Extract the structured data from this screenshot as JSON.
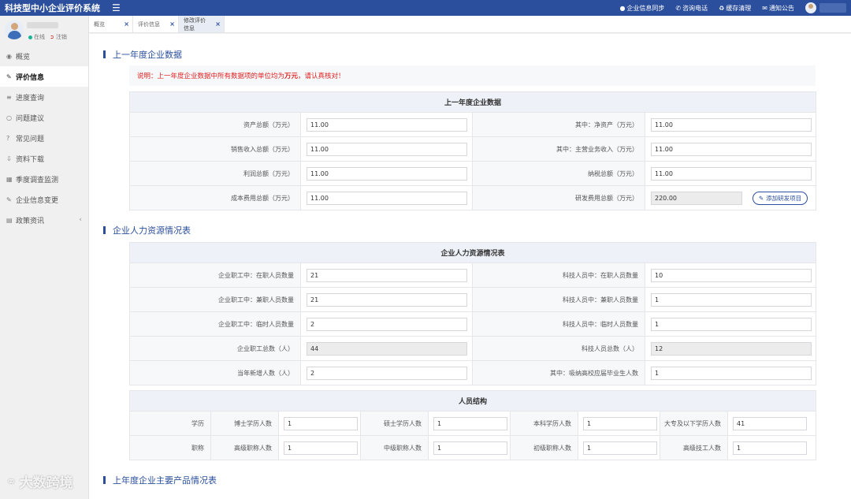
{
  "app": {
    "title": "科技型中小企业评价系统"
  },
  "topbar": {
    "actions": [
      {
        "icon": "user-icon",
        "label": "企业信息同步"
      },
      {
        "icon": "phone-icon",
        "label": "咨询电话"
      },
      {
        "icon": "recycle-icon",
        "label": "缓存清理"
      },
      {
        "icon": "mail-icon",
        "label": "通知公告"
      }
    ]
  },
  "sidebar": {
    "status_online": "在线",
    "status_logout": "注销",
    "items": [
      {
        "label": "概览",
        "icon": "dashboard-icon"
      },
      {
        "label": "评价信息",
        "icon": "edit-icon",
        "active": true
      },
      {
        "label": "进度查询",
        "icon": "progress-icon"
      },
      {
        "label": "问题建议",
        "icon": "chat-icon"
      },
      {
        "label": "常见问题",
        "icon": "question-icon"
      },
      {
        "label": "资料下载",
        "icon": "download-icon"
      },
      {
        "label": "季度调查监测",
        "icon": "grid-icon"
      },
      {
        "label": "企业信息变更",
        "icon": "edit-icon"
      },
      {
        "label": "政策资讯",
        "icon": "news-icon"
      }
    ]
  },
  "tabs": [
    {
      "label": "概览"
    },
    {
      "label": "评价信息"
    },
    {
      "label": "修改评价信息",
      "active": true
    }
  ],
  "section1": {
    "title": "上一年度企业数据",
    "notice_prefix": "说明：上一年度企业数据中所有数据项的单位均为",
    "notice_unit": "万元",
    "notice_suffix": "，请认真核对！",
    "table_header": "上一年度企业数据",
    "rows": [
      {
        "l1": "资产总额（万元）",
        "v1": "11.00",
        "l2": "其中：净资产（万元）",
        "v2": "11.00"
      },
      {
        "l1": "销售收入总额（万元）",
        "v1": "11.00",
        "l2": "其中：主营业务收入（万元）",
        "v2": "11.00"
      },
      {
        "l1": "利润总额（万元）",
        "v1": "11.00",
        "l2": "纳税总额（万元）",
        "v2": "11.00"
      },
      {
        "l1": "成本费用总额（万元）",
        "v1": "11.00",
        "l2": "研发费用总额（万元）",
        "v2": "220.00"
      }
    ],
    "add_rd_button": "添加研发项目"
  },
  "section2": {
    "title": "企业人力资源情况表",
    "table_header": "企业人力资源情况表",
    "rows": [
      {
        "l1": "企业职工中：在职人员数量",
        "v1": "21",
        "l2": "科技人员中：在职人员数量",
        "v2": "10"
      },
      {
        "l1": "企业职工中：兼职人员数量",
        "v1": "21",
        "l2": "科技人员中：兼职人员数量",
        "v2": "1"
      },
      {
        "l1": "企业职工中：临时人员数量",
        "v1": "2",
        "l2": "科技人员中：临时人员数量",
        "v2": "1"
      },
      {
        "l1": "企业职工总数（人）",
        "v1": "44",
        "l2": "科技人员总数（人）",
        "v2": "12"
      },
      {
        "l1": "当年新增人数（人）",
        "v1": "2",
        "l2": "其中：吸纳高校应届毕业生人数",
        "v2": "1"
      }
    ]
  },
  "personnel": {
    "header": "人员结构",
    "education": {
      "label": "学历",
      "fields": [
        {
          "label": "博士学历人数",
          "value": "1"
        },
        {
          "label": "硕士学历人数",
          "value": "1"
        },
        {
          "label": "本科学历人数",
          "value": "1"
        },
        {
          "label": "大专及以下学历人数",
          "value": "41"
        }
      ]
    },
    "title_rank": {
      "label": "职称",
      "fields": [
        {
          "label": "高级职称人数",
          "value": "1"
        },
        {
          "label": "中级职称人数",
          "value": "1"
        },
        {
          "label": "初级职称人数",
          "value": "1"
        },
        {
          "label": "高级技工人数",
          "value": "1"
        }
      ]
    }
  },
  "section3": {
    "title": "上年度企业主要产品情况表"
  },
  "watermark": {
    "text": "大数跨境"
  }
}
